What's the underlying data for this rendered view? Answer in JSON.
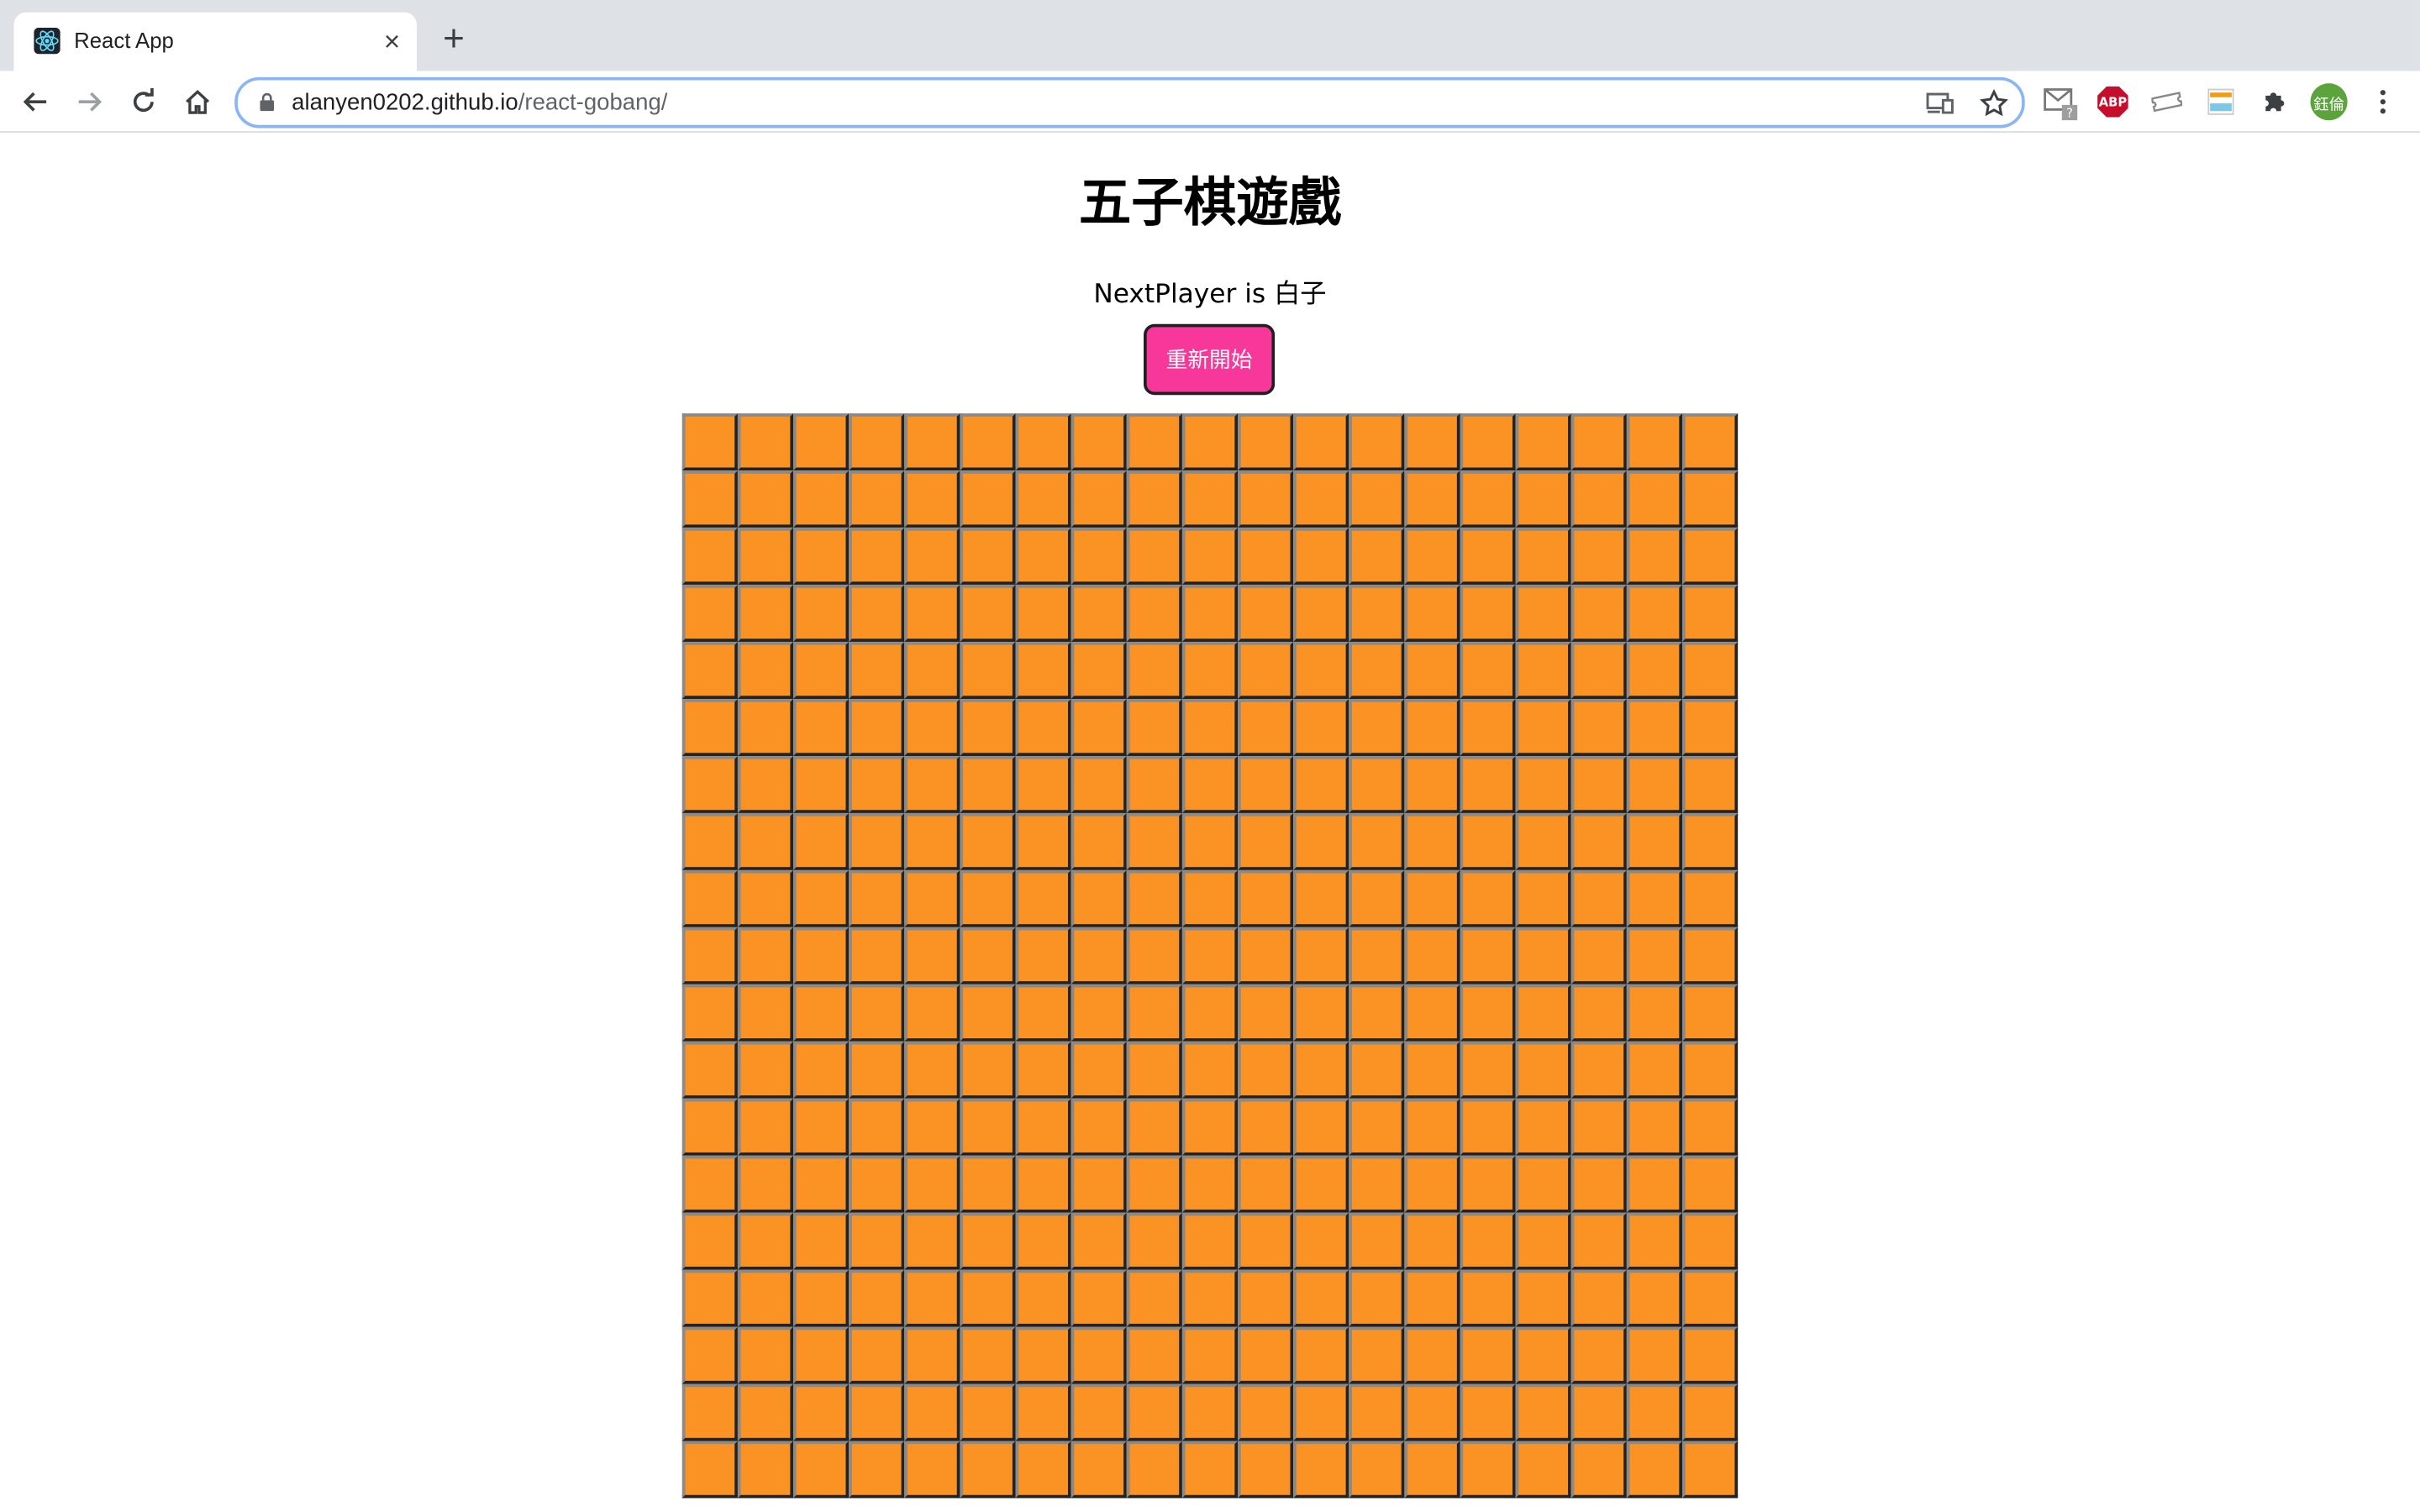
{
  "browser": {
    "tab": {
      "title": "React App",
      "favicon": "react-logo-icon"
    },
    "omnibox": {
      "url_host": "alanyen0202.github.io",
      "url_path": "/react-gobang/"
    },
    "profile": {
      "initials": "鈺倫",
      "color": "#5ba33b"
    },
    "extensions": [
      "gmail-checker-icon",
      "adblock-plus-icon",
      "ticket-icon",
      "smart-pki-icon",
      "puzzle-icon"
    ],
    "abp_label": "ABP",
    "gmail_badge": "?"
  },
  "page": {
    "title": "五子棋遊戲",
    "status": "NextPlayer is 白子",
    "restart_label": "重新開始"
  },
  "board": {
    "rows": 19,
    "cols": 19,
    "cell_color": "#fb9224",
    "stones": []
  },
  "colors": {
    "accent_button": "#f8379a",
    "board_cell": "#fb9224"
  }
}
